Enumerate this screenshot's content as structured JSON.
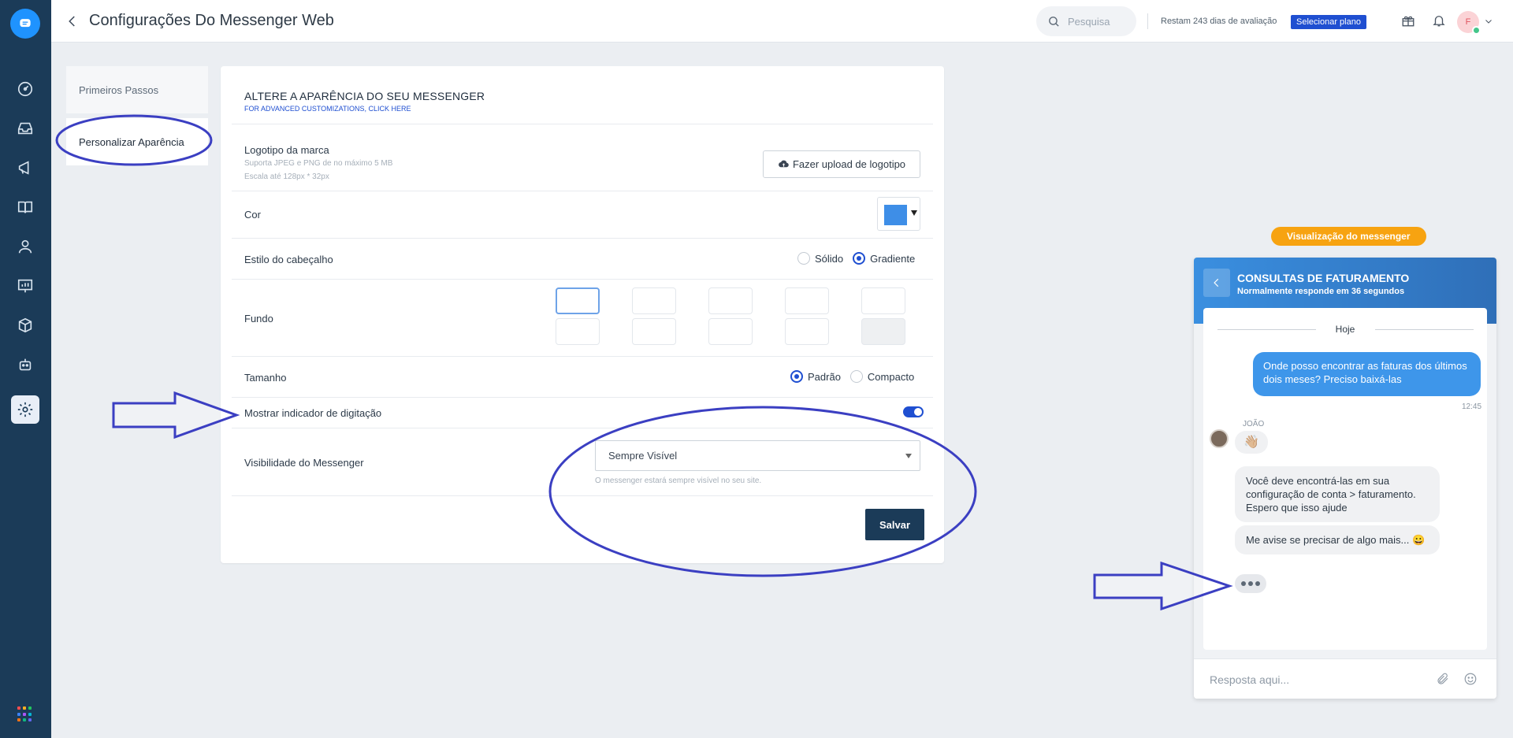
{
  "topbar": {
    "title": "Configurações Do Messenger Web",
    "search_placeholder": "Pesquisa",
    "trial_text": "Restam 243 dias de avaliação",
    "plan_button": "Selecionar plano",
    "avatar_initial": "F"
  },
  "submenu": {
    "items": [
      {
        "label": "Primeiros Passos"
      },
      {
        "label": "Personalizar Aparência"
      }
    ]
  },
  "card": {
    "heading": "ALTERE A APARÊNCIA DO SEU MESSENGER",
    "advanced_link": "FOR ADVANCED CUSTOMIZATIONS, CLICK HERE",
    "logo": {
      "label": "Logotipo da marca",
      "hint1": "Suporta JPEG e PNG de no máximo 5 MB",
      "hint2": "Escala até 128px * 32px",
      "button": "Fazer upload de logotipo"
    },
    "color": {
      "label": "Cor",
      "value": "#3e8ee7"
    },
    "header_style": {
      "label": "Estilo do cabeçalho",
      "options": [
        "Sólido",
        "Gradiente"
      ],
      "selected": "Gradiente"
    },
    "background": {
      "label": "Fundo"
    },
    "size": {
      "label": "Tamanho",
      "options": [
        "Padrão",
        "Compacto"
      ],
      "selected": "Padrão"
    },
    "typing": {
      "label": "Mostrar indicador de digitação",
      "enabled": true
    },
    "visibility": {
      "label": "Visibilidade do Messenger",
      "value": "Sempre Visível",
      "hint": "O messenger estará sempre visível no seu site."
    },
    "save_button": "Salvar"
  },
  "preview": {
    "pill": "Visualização do messenger",
    "title": "CONSULTAS DE FATURAMENTO",
    "subtitle": "Normalmente responde em 36 segundos",
    "day": "Hoje",
    "out_message": "Onde posso encontrar as faturas dos últimos dois meses? Preciso baixá-las",
    "out_time": "12:45",
    "sender": "JOÃO",
    "wave": "👋🏼",
    "in_message_1": "Você deve encontrá-las em sua configuração de conta > faturamento. Espero que isso ajude",
    "in_message_2": "Me avise se precisar de algo mais... 😀",
    "reply_placeholder": "Resposta aqui..."
  },
  "colors": {
    "rail": "#1b3b58",
    "accent": "#1f4fd1",
    "preview_pill": "#f7a311",
    "annotation": "#3b3fc2"
  }
}
